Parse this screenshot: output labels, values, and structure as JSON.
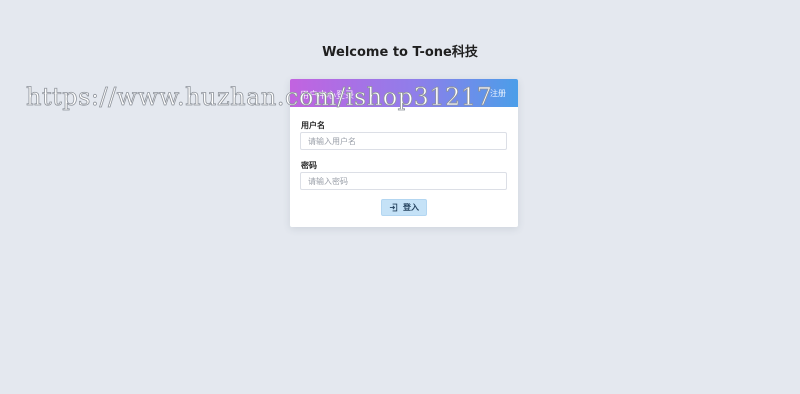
{
  "welcome_title": "Welcome to T-one科技",
  "login_card": {
    "title": "用户中心登录",
    "register_link": "注册",
    "username": {
      "label": "用户名",
      "placeholder": "请输入用户名",
      "value": ""
    },
    "password": {
      "label": "密码",
      "placeholder": "请输入密码",
      "value": ""
    },
    "login_button": {
      "label": "登入",
      "icon": "login-icon"
    },
    "header_gradient": [
      "#c263e0",
      "#4b9ee9"
    ]
  },
  "watermark": "https://www.huzhan.com/ishop31217"
}
